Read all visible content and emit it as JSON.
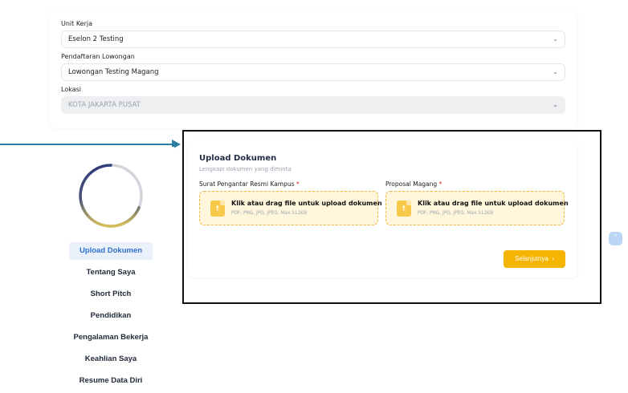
{
  "form": {
    "unit_kerja": {
      "label": "Unit Kerja",
      "value": "Eselon 2 Testing"
    },
    "pendaftaran": {
      "label": "Pendaftaran Lowongan",
      "value": "Lowongan Testing Magang"
    },
    "lokasi": {
      "label": "Lokasi",
      "value": "KOTA JAKARTA PUSAT"
    }
  },
  "icons": {
    "chevron": "chevron-down-icon",
    "file": "file-upload-icon",
    "arrow": "arrow-right-icon",
    "scroll": "chevron-up-icon"
  },
  "sidebar": {
    "items": [
      {
        "label": "Upload Dokumen",
        "active": true
      },
      {
        "label": "Tentang Saya"
      },
      {
        "label": "Short Pitch"
      },
      {
        "label": "Pendidikan"
      },
      {
        "label": "Pengalaman Bekerja"
      },
      {
        "label": "Keahlian Saya"
      },
      {
        "label": "Resume Data Diri"
      }
    ]
  },
  "upload": {
    "title": "Upload Dokumen",
    "subtitle": "Lengkapi dokumen yang diminta",
    "fields": [
      {
        "label": "Surat Pengantar Resmi Kampus",
        "required": "*",
        "prompt": "Klik atau drag file untuk upload dokumen",
        "hint": "PDF, PNG, JPG, JPEG. Max 512KB"
      },
      {
        "label": "Proposal Magang",
        "required": "*",
        "prompt": "Klik atau drag file untuk upload dokumen",
        "hint": "PDF, PNG, JPG, JPEG. Max 512KB"
      }
    ],
    "next_label": "Selanjutnya",
    "next_glyph": "›"
  },
  "colors": {
    "accent": "#f5b400",
    "active_nav": "#2f6fd1",
    "arrow": "#2a7ea3",
    "dropzone_bg": "#fff6dc"
  }
}
